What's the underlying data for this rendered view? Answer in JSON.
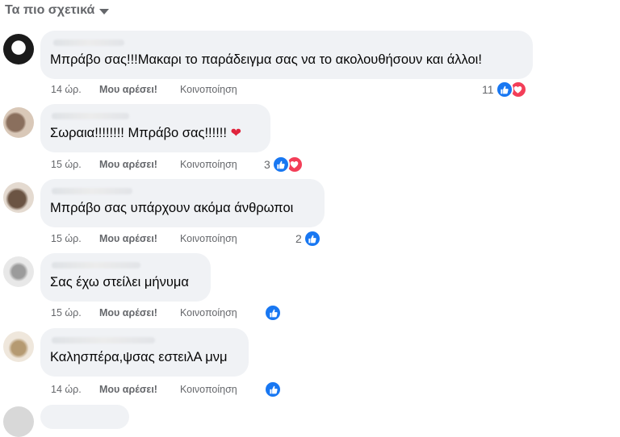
{
  "header": {
    "sort_label": "Τα πιο σχετικά"
  },
  "comments": [
    {
      "text": "Μπράβο σας!!!Μακαρι το παράδειγμα σας να το ακολουθήσουν και άλλοι!",
      "time": "14 ώρ.",
      "like_label": "Μου αρέσει!",
      "share_label": "Κοινοποίηση",
      "reaction_count": "11",
      "reactions": [
        "like",
        "love"
      ]
    },
    {
      "text": "Σωραια!!!!!!!! Μπράβο σας!!!!!!",
      "emoji": "❤",
      "time": "15 ώρ.",
      "like_label": "Μου αρέσει!",
      "share_label": "Κοινοποίηση",
      "reaction_count": "3",
      "reactions": [
        "like",
        "love"
      ]
    },
    {
      "text": "Μπράβο σας υπάρχουν ακόμα άνθρωποι",
      "time": "15 ώρ.",
      "like_label": "Μου αρέσει!",
      "share_label": "Κοινοποίηση",
      "reaction_count": "2",
      "reactions": [
        "like"
      ]
    },
    {
      "text": "Σας έχω στείλει μήνυμα",
      "time": "15 ώρ.",
      "like_label": "Μου αρέσει!",
      "share_label": "Κοινοποίηση",
      "reaction_count": "",
      "reactions": [
        "like"
      ]
    },
    {
      "text": "Καλησπέρα,ψσας εστειλΑ μνμ",
      "time": "14 ώρ.",
      "like_label": "Μου αρέσει!",
      "share_label": "Κοινοποίηση",
      "reaction_count": "",
      "reactions": [
        "like"
      ]
    }
  ],
  "colors": {
    "like": "#1877f2",
    "love": "#f33e58",
    "bubble": "#f0f2f5",
    "meta": "#65676b"
  }
}
